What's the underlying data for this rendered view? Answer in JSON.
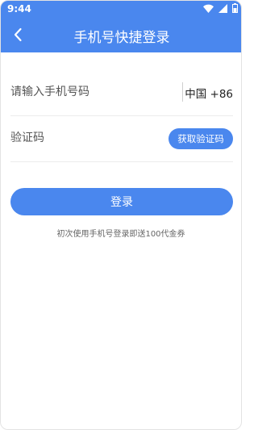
{
  "status_bar": {
    "time": "9:44",
    "icons": [
      "wifi-icon",
      "signal-icon",
      "battery-icon"
    ]
  },
  "header": {
    "title": "手机号快捷登录",
    "back_icon": "chevron-left-icon",
    "background": "#4a87ee"
  },
  "form": {
    "phone": {
      "placeholder": "请输入手机号码",
      "value": "",
      "country_code": "中国 +86"
    },
    "code": {
      "placeholder": "验证码",
      "value": "",
      "get_code_label": "获取验证码"
    },
    "login_label": "登录",
    "promo_text": "初次使用手机号登录即送100代金券"
  },
  "colors": {
    "accent": "#4a87ee",
    "text": "#333333",
    "divider": "#ececec"
  }
}
